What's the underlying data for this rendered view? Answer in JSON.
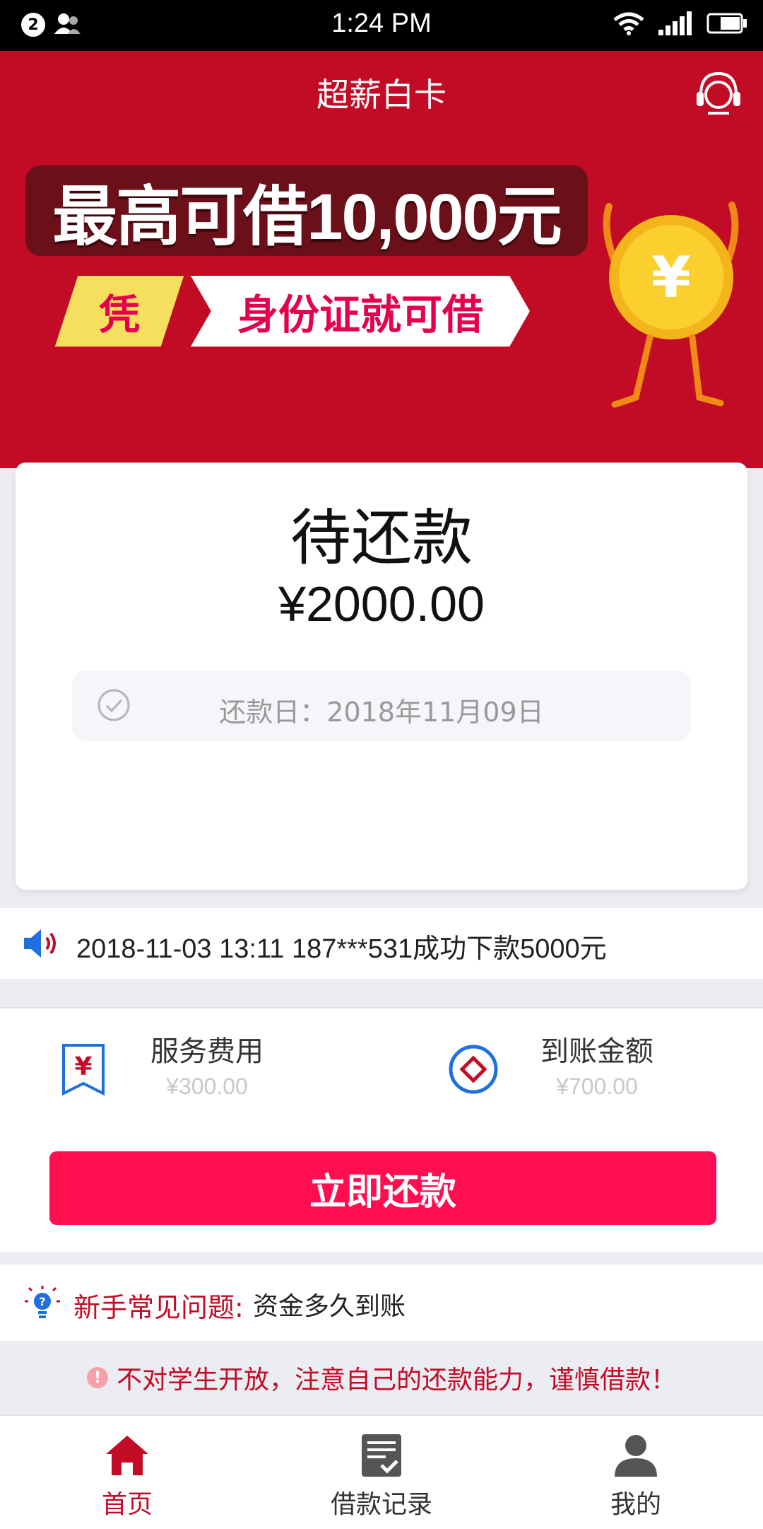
{
  "status_bar": {
    "time": "1:24 PM",
    "notification_count": "2"
  },
  "header": {
    "title": "超薪白卡",
    "support_icon": "headset-icon"
  },
  "banner": {
    "headline": "最高可借10,000元",
    "tag": "凭",
    "subline": "身份证就可借",
    "mascot": "coin-mascot-yuan"
  },
  "repayment_card": {
    "title": "待还款",
    "amount": "¥2000.00",
    "due_label": "还款日：2018年11月09日"
  },
  "notice": {
    "icon": "speaker-icon",
    "text": "2018-11-03 13:11 187***531成功下款5000元"
  },
  "fees": {
    "service_fee": {
      "label": "服务费用",
      "value": "¥300.00"
    },
    "received_amount": {
      "label": "到账金额",
      "value": "¥700.00"
    }
  },
  "actions": {
    "repay_now": "立即还款"
  },
  "faq": {
    "label": "新手常见问题:",
    "question": "资金多久到账"
  },
  "warning": {
    "text": "不对学生开放，注意自己的还款能力，谨慎借款！"
  },
  "tabs": [
    {
      "label": "首页",
      "icon": "home-icon",
      "active": true
    },
    {
      "label": "借款记录",
      "icon": "record-icon",
      "active": false
    },
    {
      "label": "我的",
      "icon": "profile-icon",
      "active": false
    }
  ],
  "colors": {
    "brand_red": "#c20c25",
    "button_pink": "#ff0e50",
    "accent_blue": "#1e6fe0"
  }
}
